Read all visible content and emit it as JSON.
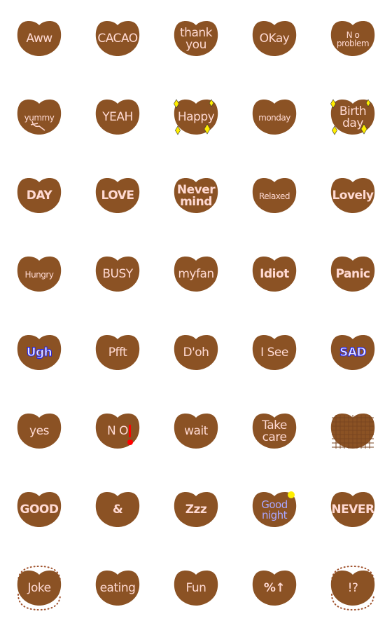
{
  "colors": {
    "heart": "#8b5224",
    "text": "#ffd9d2",
    "sparkle": "#ffee00",
    "accent_red": "#ff0000",
    "blue_outline": "#2222ee",
    "violet": "#a9a6ff"
  },
  "stickers": [
    {
      "lines": [
        "Aww"
      ]
    },
    {
      "lines": [
        "CACAO"
      ]
    },
    {
      "lines": [
        "thank",
        "you"
      ]
    },
    {
      "lines": [
        "OKay"
      ]
    },
    {
      "lines": [
        "N o",
        "problem"
      ],
      "style": "small"
    },
    {
      "lines": [
        "yummy"
      ],
      "style": "small",
      "icon": "fork-icon"
    },
    {
      "lines": [
        "YEAH"
      ]
    },
    {
      "lines": [
        "Happy"
      ],
      "icon": "sparkle-icon"
    },
    {
      "lines": [
        "monday"
      ],
      "style": "small"
    },
    {
      "lines": [
        "Birth",
        "day"
      ],
      "icon": "sparkle-icon"
    },
    {
      "lines": [
        "DAY"
      ],
      "style": "bold"
    },
    {
      "lines": [
        "LOVE"
      ],
      "style": "bold"
    },
    {
      "lines": [
        "Never",
        "mind"
      ],
      "style": "bold"
    },
    {
      "lines": [
        "Relaxed"
      ],
      "style": "small"
    },
    {
      "lines": [
        "Lovely"
      ],
      "style": "bold"
    },
    {
      "lines": [
        "Hungry"
      ],
      "style": "small"
    },
    {
      "lines": [
        "BUSY"
      ]
    },
    {
      "lines": [
        "myfan"
      ]
    },
    {
      "lines": [
        "Idiot"
      ],
      "style": "bold"
    },
    {
      "lines": [
        "Panic"
      ],
      "style": "bold"
    },
    {
      "lines": [
        "Ugh"
      ],
      "style": "blue"
    },
    {
      "lines": [
        "Pfft"
      ]
    },
    {
      "lines": [
        "D'oh"
      ]
    },
    {
      "lines": [
        "I See"
      ]
    },
    {
      "lines": [
        "SAD"
      ],
      "style": "blue"
    },
    {
      "lines": [
        "yes"
      ]
    },
    {
      "lines": [
        "N O"
      ],
      "icon": "exclamation-icon"
    },
    {
      "lines": [
        "wait"
      ]
    },
    {
      "lines": [
        "Take",
        "care"
      ]
    },
    {
      "lines": [],
      "icon": "waffle-pattern-icon"
    },
    {
      "lines": [
        "GOOD"
      ],
      "style": "bold"
    },
    {
      "lines": [
        "&"
      ],
      "style": "bold"
    },
    {
      "lines": [
        "Zzz"
      ],
      "style": "bold"
    },
    {
      "lines": [
        "Good",
        "night"
      ],
      "style": "violet",
      "icon": "moon-icon"
    },
    {
      "lines": [
        "NEVER"
      ],
      "style": "bold"
    },
    {
      "lines": [
        "Joke"
      ],
      "icon": "dotted-frame-icon"
    },
    {
      "lines": [
        "eating"
      ]
    },
    {
      "lines": [
        "Fun"
      ]
    },
    {
      "lines": [
        "%↑"
      ],
      "style": "bold"
    },
    {
      "lines": [
        "!?"
      ],
      "icon": "dotted-frame-icon"
    }
  ]
}
